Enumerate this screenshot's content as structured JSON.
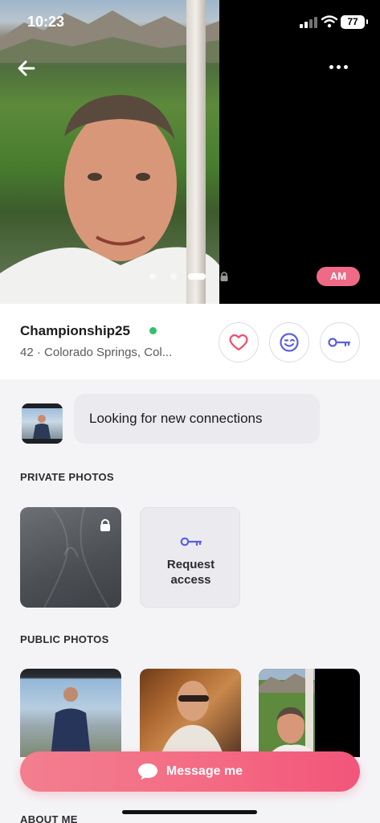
{
  "status_bar": {
    "time": "10:23",
    "battery": "77"
  },
  "profile": {
    "username": "Championship25",
    "details": "42 · Colorado Springs, Col...",
    "badge": "AM",
    "online_color": "#33c26a"
  },
  "icons": {
    "back": "arrow-left-icon",
    "more": "ellipsis-icon",
    "heart": "heart-icon",
    "wink": "wink-face-icon",
    "key": "key-icon",
    "lock": "lock-icon",
    "message": "chat-bubble-icon"
  },
  "status_message": "Looking for new connections",
  "sections": {
    "private_photos": "PRIVATE PHOTOS",
    "public_photos": "PUBLIC PHOTOS",
    "about_me": "ABOUT ME"
  },
  "request_access": {
    "label": "Request\naccess"
  },
  "message_button": {
    "label": "Message me"
  },
  "colors": {
    "accent_pink": "#f46b84",
    "accent_blue": "#5b5fe0",
    "heart_pink": "#ef4d6a"
  }
}
